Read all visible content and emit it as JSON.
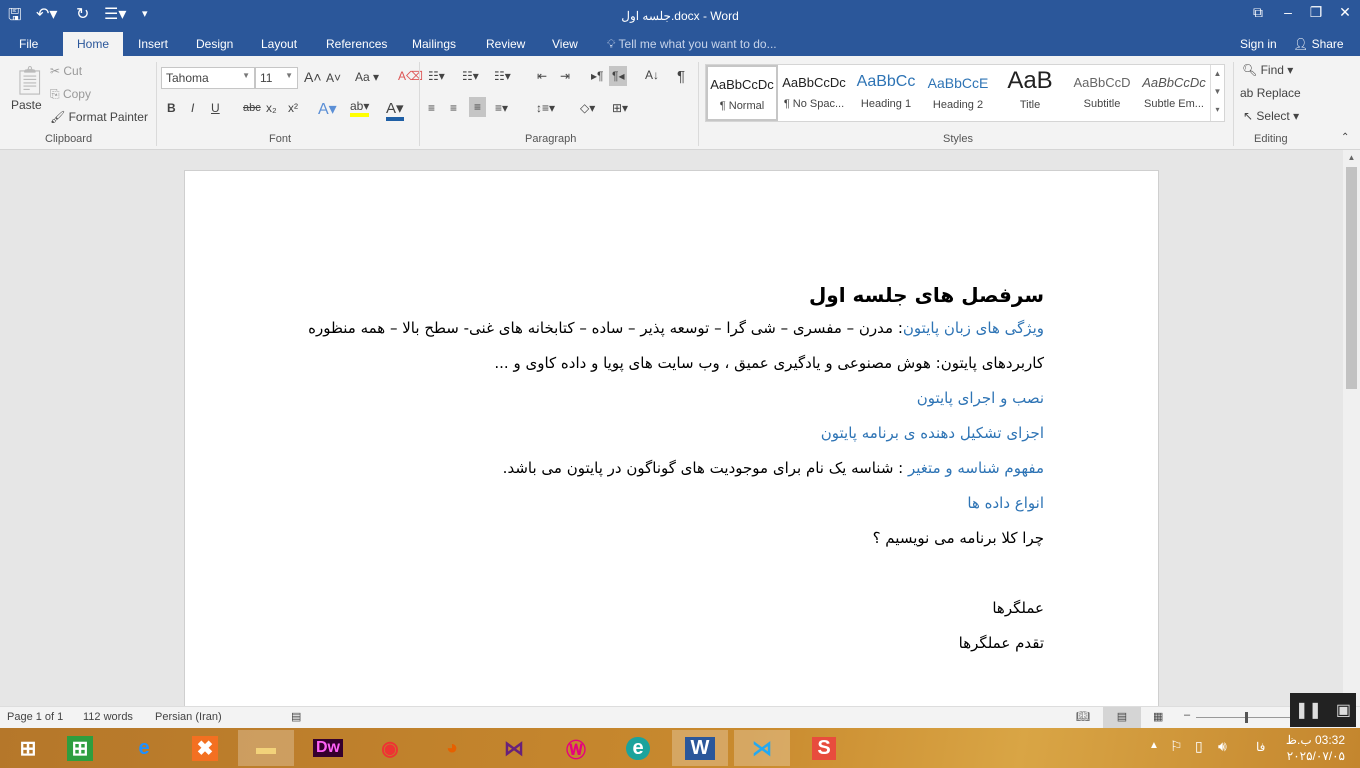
{
  "window": {
    "title": "جلسه اول.docx - Word",
    "controls": [
      "ribbon-display",
      "minimize",
      "restore",
      "close"
    ]
  },
  "quick_access": {
    "icons": [
      "save-icon",
      "undo-icon",
      "redo-icon",
      "touch-mode-icon",
      "customize-icon"
    ]
  },
  "tabs": [
    {
      "label": "File"
    },
    {
      "label": "Home"
    },
    {
      "label": "Insert"
    },
    {
      "label": "Design"
    },
    {
      "label": "Layout"
    },
    {
      "label": "References"
    },
    {
      "label": "Mailings"
    },
    {
      "label": "Review"
    },
    {
      "label": "View"
    }
  ],
  "tell_me": "Tell me what you want to do...",
  "account": {
    "sign_in": "Sign in",
    "share": "Share"
  },
  "clipboard": {
    "paste": "Paste",
    "cut": "Cut",
    "copy": "Copy",
    "format_painter": "Format Painter",
    "group": "Clipboard"
  },
  "font": {
    "name": "Tahoma",
    "size": "11",
    "change_case": "Aa",
    "group": "Font",
    "bold": "B",
    "italic": "I",
    "underline": "U",
    "strike": "abc",
    "sub": "x₂",
    "sup": "x²"
  },
  "paragraph": {
    "group": "Paragraph",
    "show_marks": "¶"
  },
  "styles": {
    "group": "Styles",
    "items": [
      {
        "preview": "AaBbCcDc",
        "name": "¶ Normal"
      },
      {
        "preview": "AaBbCcDc",
        "name": "¶ No Spac..."
      },
      {
        "preview": "AaBbCc",
        "name": "Heading 1"
      },
      {
        "preview": "AaBbCcE",
        "name": "Heading 2"
      },
      {
        "preview": "AaB",
        "name": "Title"
      },
      {
        "preview": "AaBbCcD",
        "name": "Subtitle"
      },
      {
        "preview": "AaBbCcDc",
        "name": "Subtle Em..."
      }
    ]
  },
  "editing": {
    "group": "Editing",
    "find": "Find",
    "replace": "Replace",
    "select": "Select"
  },
  "document": {
    "title": "سرفصل های جلسه اول",
    "p1_label": "ویژگی های زبان پایتون",
    "p1_text": ": مدرن – مفسری – شی گرا – توسعه پذیر – ساده – کتابخانه های غنی- سطح بالا – همه منظوره",
    "p2": "کاربردهای پایتون: هوش مصنوعی و یادگیری عمیق ، وب سایت های پویا و داده کاوی و ...",
    "p3": "نصب و اجرای پایتون",
    "p4": "اجزای تشکیل دهنده ی برنامه پایتون",
    "p5_label": "مفهوم شناسه و متغیر",
    "p5_text": " : شناسه یک نام برای موجودیت های گوناگون در پایتون می باشد.",
    "p6": "انواع داده ها",
    "p7": "چرا کلا برنامه می نویسیم ؟",
    "p8": "عملگرها",
    "p9": "تقدم عملگرها"
  },
  "status": {
    "page": "Page 1 of 1",
    "words": "112 words",
    "language": "Persian (Iran)"
  },
  "taskbar": {
    "apps": [
      "windows-start",
      "store",
      "internet-explorer",
      "xampp",
      "file-explorer",
      "dreamweaver",
      "chrome",
      "firefox",
      "visual-studio",
      "wamp",
      "e-app",
      "word",
      "vscode",
      "sublime"
    ],
    "labels": {
      "dreamweaver": "Dw",
      "word": "W"
    },
    "lang": "فا",
    "time": "03:32 ب.ظ",
    "date": "۲۰۲۵/۰۷/۰۵"
  }
}
